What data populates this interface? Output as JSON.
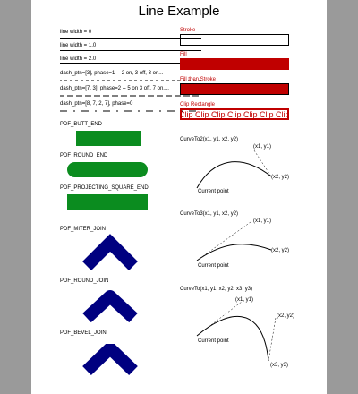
{
  "title": "Line Example",
  "left": {
    "line_labels": [
      "line width = 0",
      "line width = 1.0",
      "line width = 2.0",
      "dash_ptn=[3], phase=1 -- 2 on, 3 off, 3 on...",
      "dash_ptn=[7, 3], phase=2 -- 5 on 3 off, 7 on,...",
      "dash_ptn=[8, 7, 2, 7], phase=0"
    ],
    "cap_labels": [
      "PDF_BUTT_END",
      "PDF_ROUND_END",
      "PDF_PROJECTING_SQUARE_END"
    ],
    "join_labels": [
      "PDF_MITER_JOIN",
      "PDF_ROUND_JOIN",
      "PDF_BEVEL_JOIN"
    ]
  },
  "right": {
    "stroke_label": "Stroke",
    "fill_label": "Fill",
    "fill_stroke_label": "Fill then Stroke",
    "clip_label": "Clip Rectangle",
    "clip_text": "Clip Clip Clip Clip Clip Clip Clip Clip",
    "curve2_title": "CurveTo2(x1, y1, x2, y2)",
    "curve3_title": "CurveTo3(x1, y1, x2, y2)",
    "curve_title": "CurveTo(x1, y1, x2, y2, x3, y3)",
    "current_point": "Current point",
    "x1y1": "(x1, y1)",
    "x2y2": "(x2, y2)",
    "x3y3": "(x3, y3)"
  },
  "colors": {
    "red": "#c00000",
    "green": "#0b8c1f",
    "navy": "#000080",
    "background": "#9a9a9a"
  }
}
